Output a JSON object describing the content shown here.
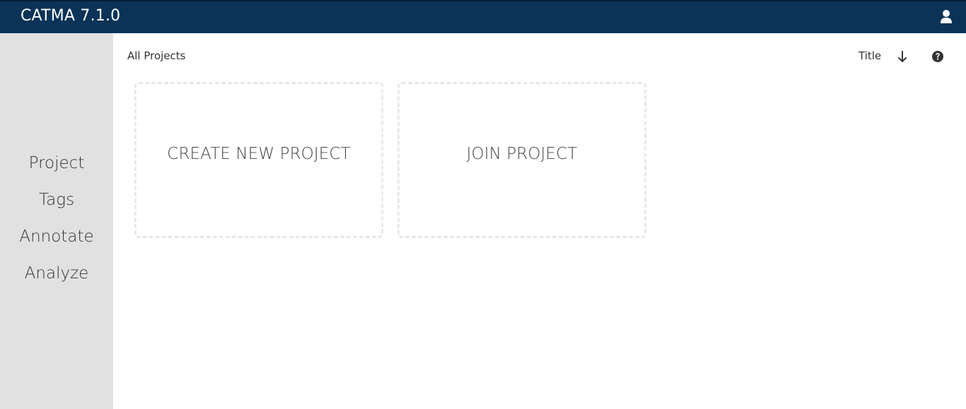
{
  "header": {
    "app_title": "CATMA 7.1.0",
    "user_icon": "user-icon",
    "background_color": "#0a3357"
  },
  "sidebar": {
    "background_color": "#e1e1e1",
    "items": [
      {
        "label": "Project"
      },
      {
        "label": "Tags"
      },
      {
        "label": "Annotate"
      },
      {
        "label": "Analyze"
      }
    ]
  },
  "toolbar": {
    "breadcrumb": "All Projects",
    "sort_label": "Title",
    "sort_icon": "arrow-down-icon",
    "help_icon": "help-circle-icon"
  },
  "cards": [
    {
      "label": "CREATE NEW PROJECT"
    },
    {
      "label": "JOIN PROJECT"
    }
  ]
}
